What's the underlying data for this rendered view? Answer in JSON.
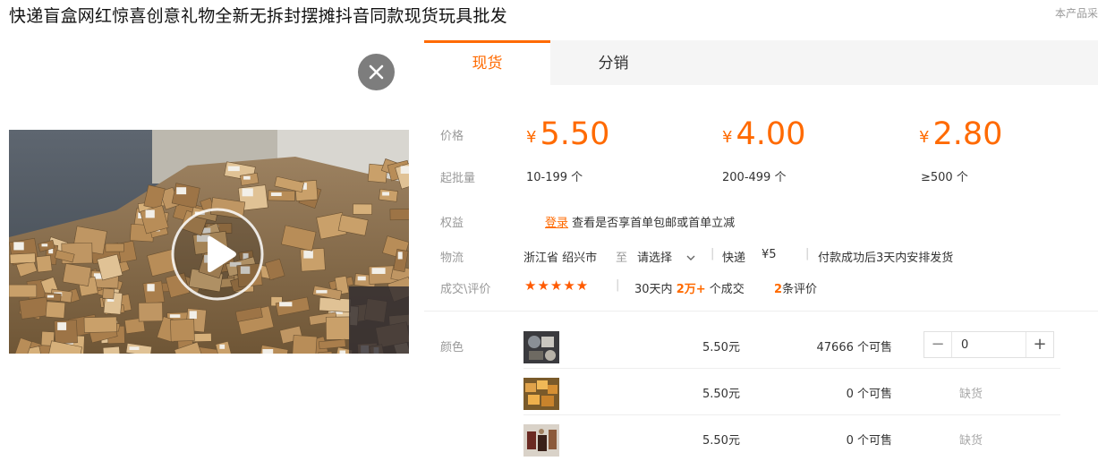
{
  "product": {
    "title": "快递盲盒网红惊喜创意礼物全新无拆封摆摊抖音同款现货玩具批发",
    "corner_note": "本产品采"
  },
  "media": {
    "close_icon": "close-icon",
    "play_icon": "play-icon"
  },
  "tabs": [
    {
      "label": "现货",
      "active": true
    },
    {
      "label": "分销",
      "active": false
    }
  ],
  "pricing": {
    "price_label": "价格",
    "moq_label": "起批量",
    "currency": "¥",
    "tiers": [
      {
        "price": "5.50",
        "range": "10-199 个"
      },
      {
        "price": "4.00",
        "range": "200-499 个"
      },
      {
        "price": "2.80",
        "range": "≥500 个"
      }
    ]
  },
  "benefits": {
    "label": "权益",
    "login_link": "登录",
    "text": "查看是否享首单包邮或首单立减"
  },
  "logistics": {
    "label": "物流",
    "origin": "浙江省 绍兴市",
    "to": "至",
    "destination": "请选择",
    "sep1": "|",
    "method": "快递",
    "fee": "¥5",
    "sep2": "|",
    "note": "付款成功后3天内安排发货"
  },
  "reviews": {
    "label": "成交\\评价",
    "stars": "★★★★★",
    "sep": "|",
    "period": "30天内",
    "deals": "2万+",
    "deals_suffix": "个成交",
    "review_count": "2",
    "review_suffix": "条评价"
  },
  "skus": {
    "label": "颜色",
    "rows": [
      {
        "price": "5.50元",
        "stock": "47666 个可售",
        "quantity": "0",
        "out_label": ""
      },
      {
        "price": "5.50元",
        "stock": "0 个可售",
        "quantity": "",
        "out_label": "缺货"
      },
      {
        "price": "5.50元",
        "stock": "0 个可售",
        "quantity": "",
        "out_label": "缺货"
      }
    ],
    "minus_icon": "minus-icon",
    "plus_icon": "plus-icon"
  },
  "colors": {
    "accent": "#ff6a00",
    "stars": "#ff5a00",
    "tab_bg": "#f5f5f5"
  }
}
